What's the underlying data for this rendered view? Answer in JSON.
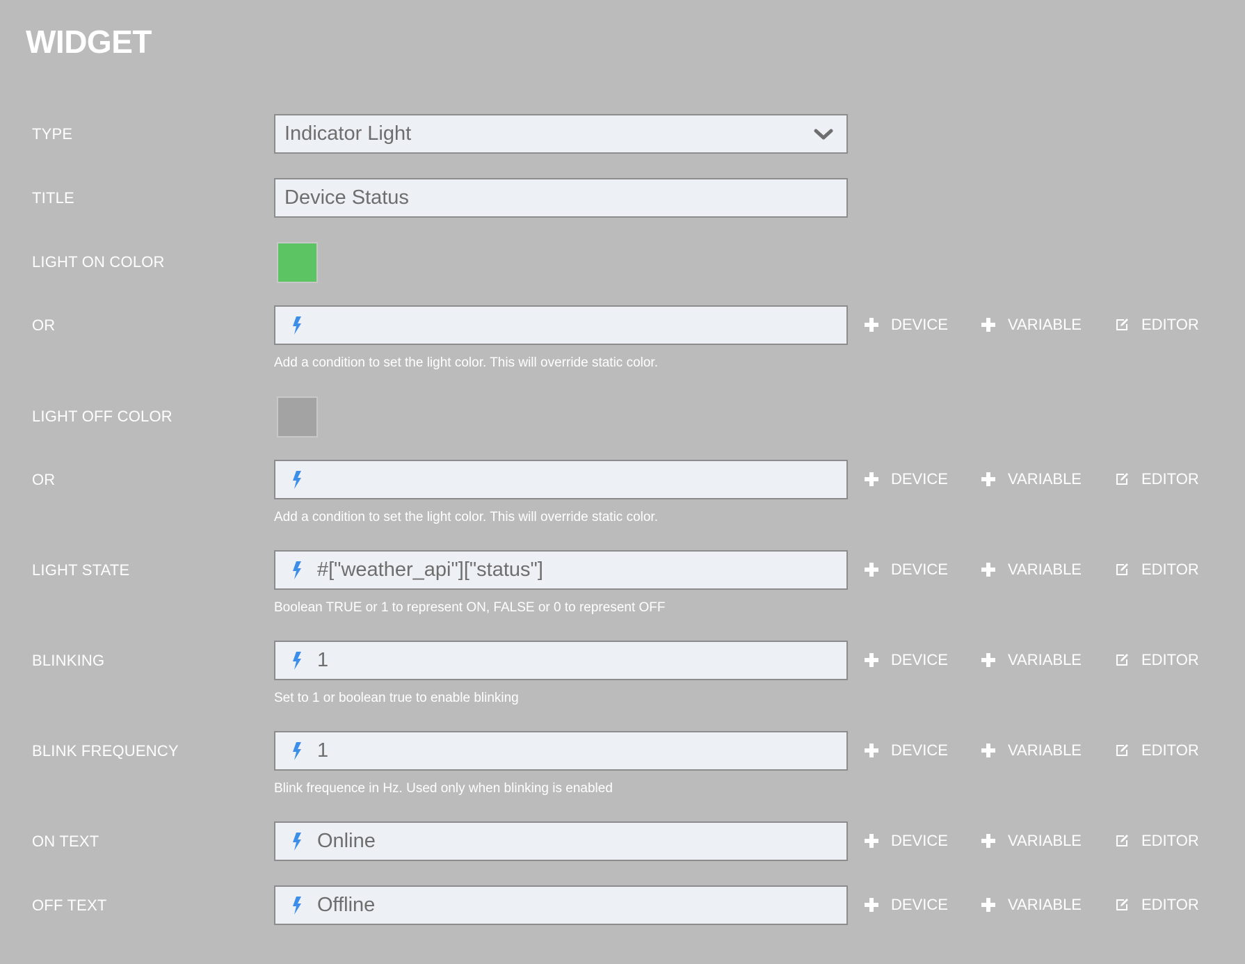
{
  "page": {
    "title": "WIDGET"
  },
  "actions": {
    "device": "DEVICE",
    "variable": "VARIABLE",
    "editor": "EDITOR"
  },
  "fields": {
    "type": {
      "label": "TYPE",
      "value": "Indicator Light"
    },
    "title": {
      "label": "TITLE",
      "value": "Device Status"
    },
    "light_on_color": {
      "label": "LIGHT ON COLOR",
      "color": "#5cc462"
    },
    "light_on_or": {
      "label": "OR",
      "value": "",
      "hint": "Add a condition to set the light color. This will override static color."
    },
    "light_off_color": {
      "label": "LIGHT OFF COLOR",
      "color": "#a3a3a3"
    },
    "light_off_or": {
      "label": "OR",
      "value": "",
      "hint": "Add a condition to set the light color. This will override static color."
    },
    "light_state": {
      "label": "LIGHT STATE",
      "value": "#[\"weather_api\"][\"status\"]",
      "hint": "Boolean TRUE or 1 to represent ON, FALSE or 0 to represent OFF"
    },
    "blinking": {
      "label": "BLINKING",
      "value": "1",
      "hint": "Set to 1 or boolean true to enable blinking"
    },
    "blink_frequency": {
      "label": "BLINK FREQUENCY",
      "value": "1",
      "hint": "Blink frequence in Hz. Used only when blinking is enabled"
    },
    "on_text": {
      "label": "ON TEXT",
      "value": "Online"
    },
    "off_text": {
      "label": "OFF TEXT",
      "value": "Offline"
    }
  },
  "colors": {
    "background": "#bbbbbb",
    "field_background": "#edf0f4",
    "bolt_icon": "#3d8ee8"
  },
  "icons": {
    "expression": "bolt-icon",
    "add": "plus-icon",
    "editor": "edit-icon",
    "dropdown": "chevron-down-icon"
  }
}
